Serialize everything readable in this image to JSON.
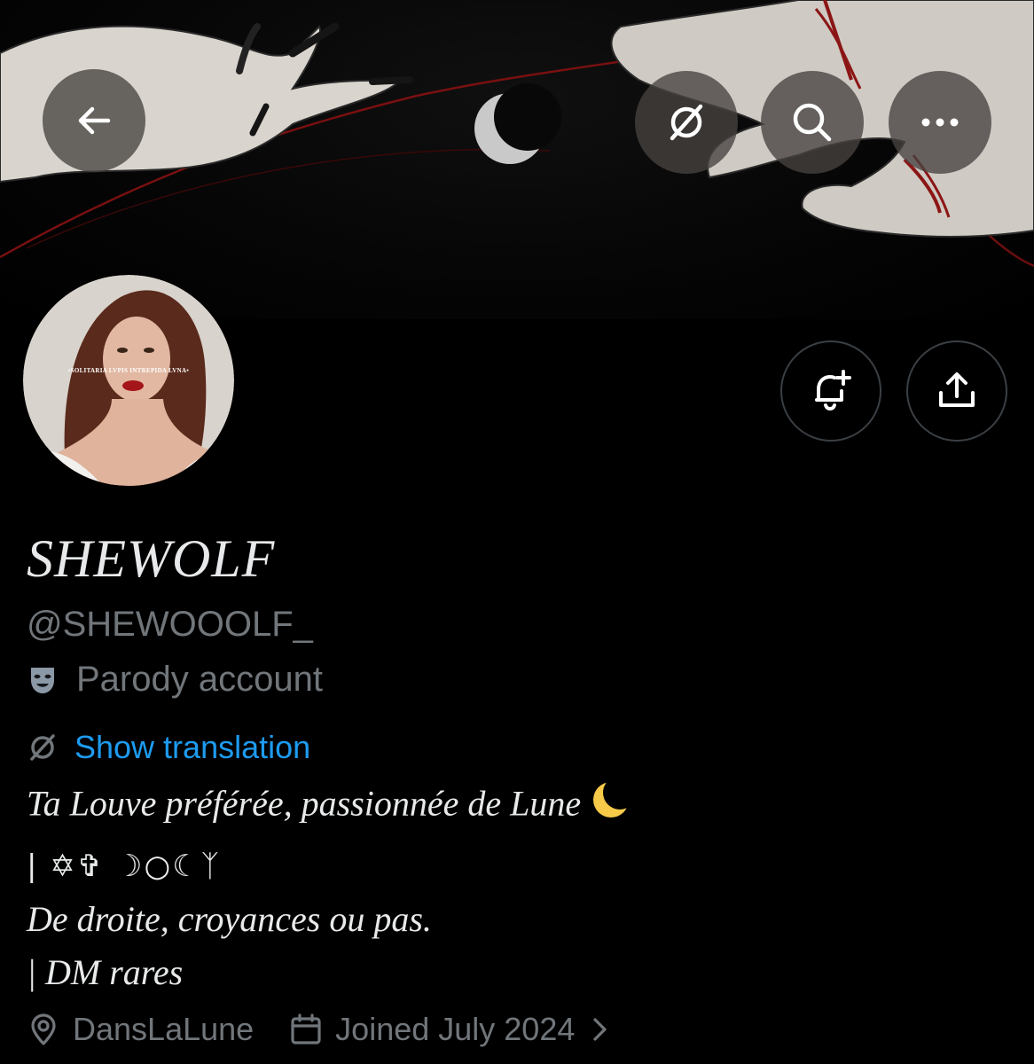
{
  "header": {
    "back_icon": "arrow-left-icon",
    "translate_icon": "translate-icon",
    "search_icon": "search-icon",
    "more_icon": "more-dots-icon"
  },
  "profile": {
    "display_name": "SHEWOLF",
    "handle": "@SHEWOOOLF_",
    "avatar_caption": "•SOLITARIA LVPIS INTREPIDA LVNA•",
    "label_icon": "theater-mask-icon",
    "label": "Parody account",
    "show_translation": "Show translation",
    "bio": {
      "line1": "Ta Louve préférée, passionnée de Lune",
      "line2": "| ✡✞ ☽○☾ᛉ",
      "line3": "De droite, croyances ou pas.",
      "line4": "| DM rares"
    },
    "location": "DansLaLune",
    "joined": "Joined July 2024"
  },
  "actions": {
    "notify_icon": "bell-plus-icon",
    "share_icon": "share-upload-icon"
  },
  "colors": {
    "background": "#000000",
    "text_primary": "#e7e9ea",
    "text_secondary": "#71767b",
    "link": "#1d9bf0",
    "button_overlay": "#46424099"
  }
}
